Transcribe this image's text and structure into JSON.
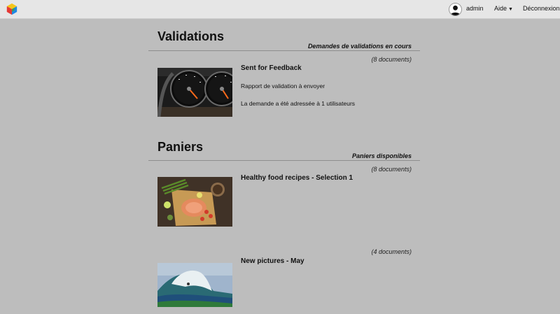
{
  "header": {
    "user_label": "admin",
    "help_label": "Aide",
    "logout_label": "Déconnexion"
  },
  "validations": {
    "title": "Validations",
    "subtitle": "Demandes de validations en cours",
    "items": [
      {
        "count_label": "(8 documents)",
        "title": "Sent for Feedback",
        "line1": "Rapport de validation à envoyer",
        "line2": "La demande a été adressée à 1 utilisateurs"
      }
    ]
  },
  "baskets": {
    "title": "Paniers",
    "subtitle": "Paniers disponibles",
    "items": [
      {
        "count_label": "(8 documents)",
        "title": "Healthy food recipes - Selection 1"
      },
      {
        "count_label": "(4 documents)",
        "title": "New pictures - May"
      }
    ]
  },
  "colors": {
    "background": "#bdbdbd",
    "topbar": "#e6e6e6",
    "rule": "#8e8e8e"
  }
}
